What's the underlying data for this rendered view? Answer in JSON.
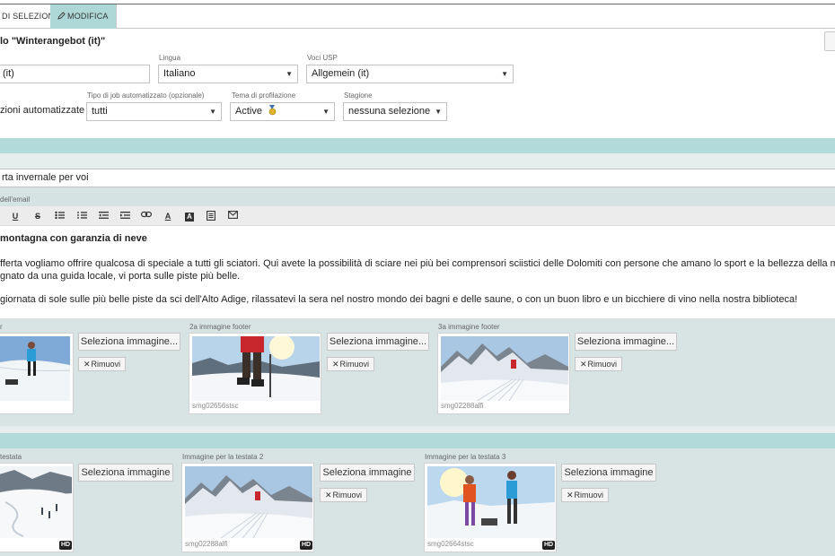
{
  "tabs": [
    {
      "label": "DI SELEZIONE"
    },
    {
      "label": "MODIFICA",
      "icon": "pencil-icon",
      "active": true
    }
  ],
  "title": "lo \"Winterangebot (it)\"",
  "form": {
    "name_value": "(it)",
    "language_label": "Lingua",
    "language_value": "Italiano",
    "usp_label": "Voci USP",
    "usp_value": "Allgemein (it)",
    "automation_text": "zioni automatizzate",
    "jobtype_label": "Tipo di job automatizzato (opzionale)",
    "jobtype_value": "tutti",
    "profile_label": "Tema di profilazione",
    "profile_value": "Active",
    "season_label": "Stagione",
    "season_value": "nessuna selezione"
  },
  "subject": {
    "value": "rta invernale per voi",
    "body_label": "dell'email"
  },
  "editor": {
    "tools": [
      "underline-icon",
      "strikethrough-icon",
      "bullet-list-icon",
      "numbered-list-icon",
      "outdent-icon",
      "indent-icon",
      "link-icon",
      "font-color-icon",
      "background-color-icon",
      "template-icon",
      "email-icon"
    ],
    "heading": "montagna con garanzia di neve",
    "para1_line1": "fferta vogliamo offrire qualcosa di speciale a tutti gli sciatori. Qui avete la possibilità di sciare nei più bei comprensori sciistici delle Dolomiti con persone che amano lo sport e la bellezza della montagna. Ogni giorno",
    "para1_line2": "gnato da una guida locale, vi porta sulle piste più belle.",
    "para2": "giornata di sole sulle più belle piste da sci dell'Alto Adige, rilassatevi la sera nel nostro mondo dei bagni e delle saune, o con un buon libro e un bicchiere di vino nella nostra biblioteca!"
  },
  "footer_images": [
    {
      "label": "r",
      "code": "",
      "select_label": "Seleziona immagine...",
      "remove_label": "Rimuovi"
    },
    {
      "label": "2a immagine footer",
      "code": "smg02656stsc",
      "select_label": "Seleziona immagine...",
      "remove_label": "Rimuovi"
    },
    {
      "label": "3a immagine footer",
      "code": "smg02288alfi",
      "select_label": "Seleziona immagine...",
      "remove_label": "Rimuovi"
    }
  ],
  "header_images": [
    {
      "label": "testata",
      "code": "",
      "select_label": "Seleziona immagine",
      "badge": "HD"
    },
    {
      "label": "Immagine per la testata 2",
      "code": "smg02288alfi",
      "select_label": "Seleziona immagine",
      "remove_label": "Rimuovi",
      "badge": "HD"
    },
    {
      "label": "Immagine per la testata 3",
      "code": "smg02664stsc",
      "select_label": "Seleziona immagine",
      "remove_label": "Rimuovi",
      "badge": "HD"
    }
  ],
  "colors": {
    "accent_band": "#b3dada",
    "panel": "#d8e4e4",
    "active_tab": "#aed8d8"
  }
}
